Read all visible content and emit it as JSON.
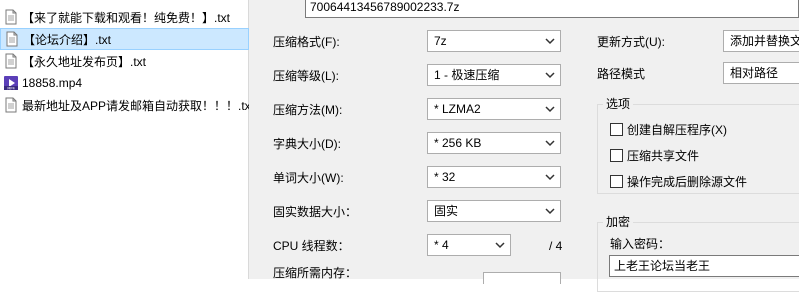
{
  "file_list": {
    "items": [
      {
        "name": "【来了就能下载和观看！纯免费！】.txt",
        "icon": "text-file-icon",
        "selected": false
      },
      {
        "name": "【论坛介绍】.txt",
        "icon": "text-file-icon",
        "selected": true
      },
      {
        "name": "【永久地址发布页】.txt",
        "icon": "text-file-icon",
        "selected": false
      },
      {
        "name": "18858.mp4",
        "icon": "video-file-icon",
        "selected": false
      },
      {
        "name": "最新地址及APP请发邮箱自动获取！！！.txt",
        "icon": "text-file-icon",
        "selected": false
      }
    ]
  },
  "archive": {
    "path": "7006441345678900​2233.7z"
  },
  "settings": {
    "format_label": "压缩格式(F):",
    "format_value": "7z",
    "level_label": "压缩等级(L):",
    "level_value": "1 - 极速压缩",
    "method_label": "压缩方法(M):",
    "method_value": "* LZMA2",
    "dict_label": "字典大小(D):",
    "dict_value": "* 256 KB",
    "word_label": "单词大小(W):",
    "word_value": "* 32",
    "solid_label": "固实数据大小：",
    "solid_value": "固实",
    "cpu_label": "CPU 线程数：",
    "cpu_value": "* 4",
    "cpu_total": "/ 4",
    "memory_label": "压缩所需内存："
  },
  "right_panel": {
    "update_label": "更新方式(U):",
    "update_value": "添加并替换文",
    "path_label": "路径模式",
    "path_value": "相对路径",
    "options_title": "选项",
    "options": [
      {
        "label": "创建自解压程序(X)",
        "checked": false
      },
      {
        "label": "压缩共享文件",
        "checked": false
      },
      {
        "label": "操作完成后删除源文件",
        "checked": false
      }
    ],
    "encrypt_title": "加密",
    "password_label": "输入密码：",
    "password_value": "上老王论坛当老王"
  }
}
